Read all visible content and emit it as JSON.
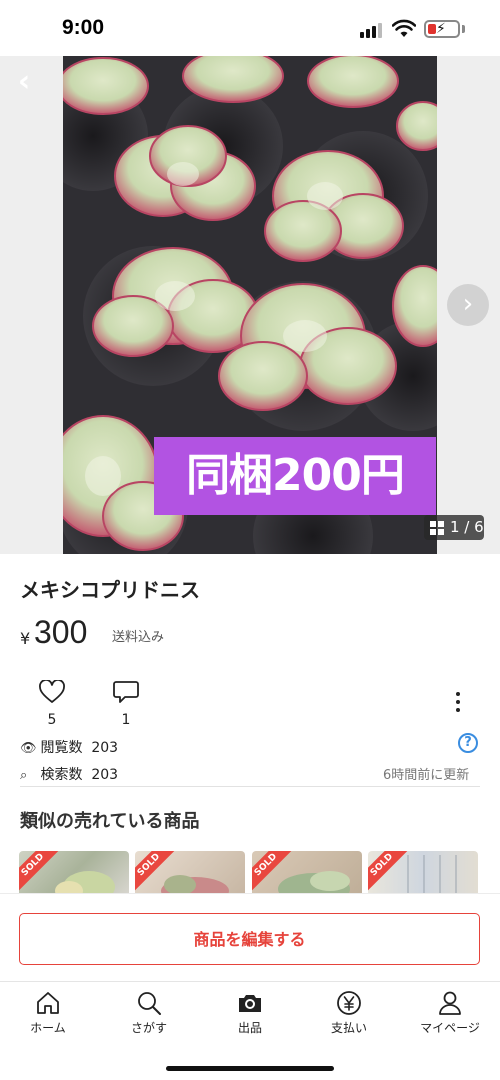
{
  "status_bar": {
    "time": "9:00"
  },
  "gallery": {
    "caption": "同梱200円",
    "counter": "1 / 6"
  },
  "product": {
    "title": "メキシコプリドニス",
    "currency": "¥",
    "price": "300",
    "shipping": "送料込み"
  },
  "actions": {
    "like_count": "5",
    "comment_count": "1"
  },
  "stats": {
    "views_label": "閲覧数",
    "views": "203",
    "search_label": "検索数",
    "search": "203",
    "updated": "6時間前に更新"
  },
  "similar": {
    "title": "類似の売れている商品",
    "sold_label": "SOLD"
  },
  "edit_button": "商品を編集する",
  "tabs": [
    {
      "label": "ホーム",
      "icon": "home-icon"
    },
    {
      "label": "さがす",
      "icon": "search-icon"
    },
    {
      "label": "出品",
      "icon": "camera-icon"
    },
    {
      "label": "支払い",
      "icon": "yen-icon"
    },
    {
      "label": "マイページ",
      "icon": "person-icon"
    }
  ],
  "colors": {
    "accent": "#e6433b",
    "caption_bg": "#b253e2",
    "help": "#3a8de0"
  }
}
